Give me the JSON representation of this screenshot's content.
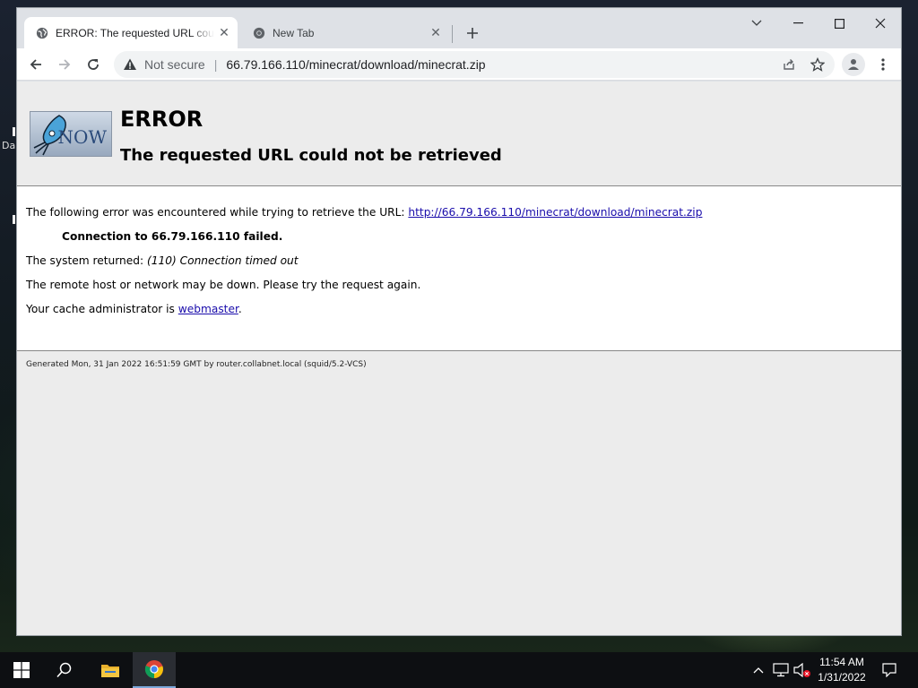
{
  "desktop": {
    "edge_text": "Da"
  },
  "browser": {
    "tabs": [
      {
        "title": "ERROR: The requested URL could not be retrieved",
        "active": true
      },
      {
        "title": "New Tab",
        "active": false
      }
    ],
    "address": {
      "security_label": "Not secure",
      "separator": "|",
      "url": "66.79.166.110/minecrat/download/minecrat.zip"
    }
  },
  "page": {
    "logo_text": "NOW",
    "title": "ERROR",
    "subtitle": "The requested URL could not be retrieved",
    "intro_text": "The following error was encountered while trying to retrieve the URL: ",
    "error_url": "http://66.79.166.110/minecrat/download/minecrat.zip",
    "connection_failed": "Connection to 66.79.166.110 failed.",
    "system_returned_label": "The system returned: ",
    "system_returned_value": "(110) Connection timed out",
    "remote_host_text": "The remote host or network may be down. Please try the request again.",
    "cache_admin_text": "Your cache administrator is ",
    "cache_admin_link": "webmaster",
    "cache_admin_suffix": ".",
    "footer": "Generated Mon, 31 Jan 2022 16:51:59 GMT by router.collabnet.local (squid/5.2-VCS)"
  },
  "taskbar": {
    "time": "11:54 AM",
    "date": "1/31/2022"
  },
  "colors": {
    "link": "#1a0dab",
    "page_header_bg": "#ececec",
    "taskbar_bg": "#0d0f12",
    "chrome_frame": "#dee1e6"
  }
}
